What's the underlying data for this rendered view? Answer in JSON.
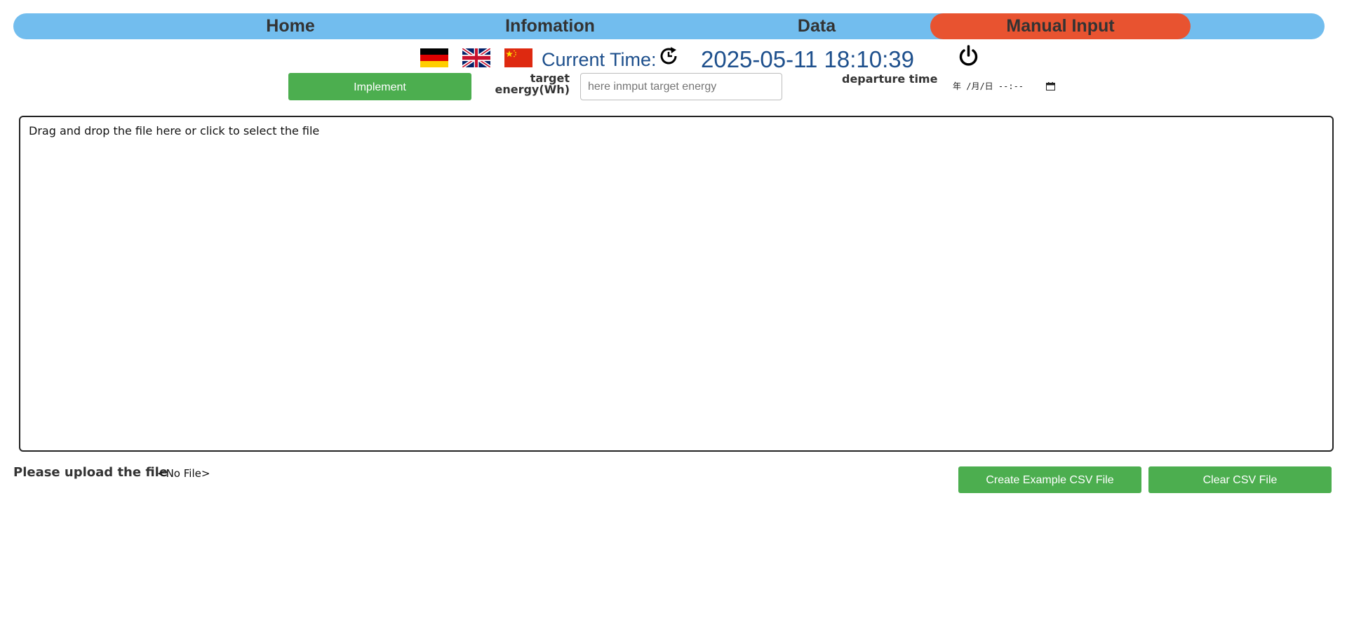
{
  "nav": {
    "home": "Home",
    "info": "Infomation",
    "data": "Data",
    "manual": "Manual Input",
    "active_color": "#e85330",
    "bar_color": "#72bdee"
  },
  "languages": [
    {
      "name": "german-flag-icon"
    },
    {
      "name": "uk-flag-icon"
    },
    {
      "name": "china-flag-icon"
    }
  ],
  "clock": {
    "label": "Current Time:",
    "value": "2025-05-11 18:10:39",
    "color": "#1d4f8c"
  },
  "form": {
    "implement_label": "Implement",
    "target_energy_label": "target energy(Wh)",
    "target_energy_placeholder": "here inmput target energy",
    "departure_label": "departure time",
    "departure_value": "年 /月/日 --:--",
    "button_color": "#4cae4f"
  },
  "dropzone": {
    "text": "Drag and drop the file here or click to select the file"
  },
  "upload": {
    "label": "Please upload the file",
    "status": "<No File>",
    "create_label": "Create Example CSV File",
    "clear_label": "Clear CSV File"
  }
}
